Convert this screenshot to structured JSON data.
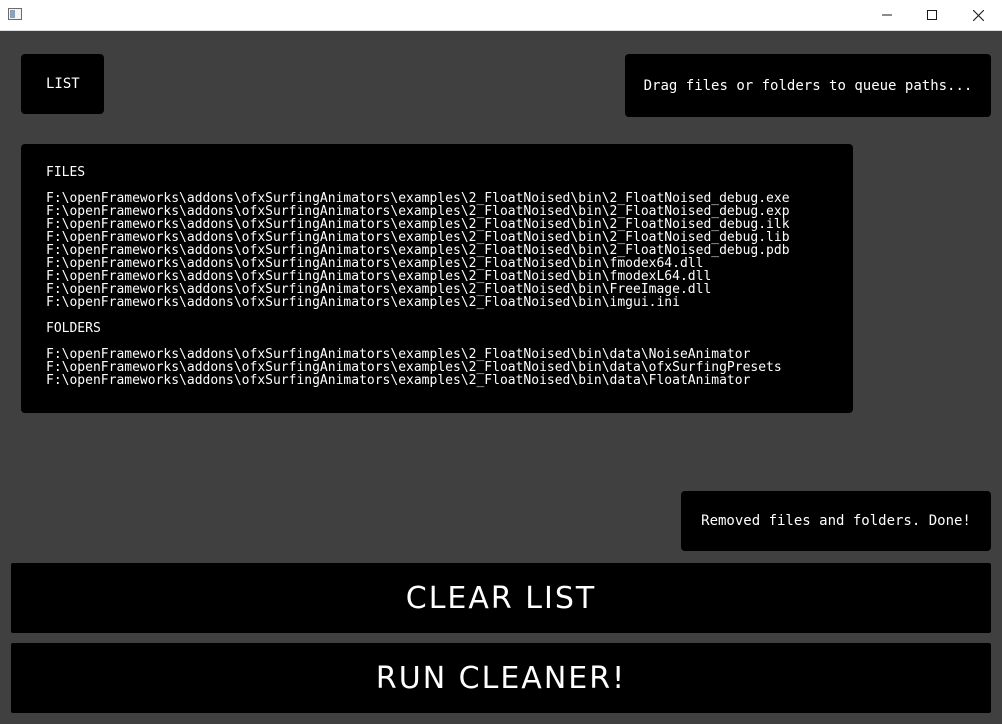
{
  "window": {
    "title": "",
    "controls": {
      "minimize_icon": "minimize-icon",
      "maximize_icon": "maximize-icon",
      "close_icon": "close-icon"
    }
  },
  "list_button": {
    "label": "LIST"
  },
  "drop_zone": {
    "label": "Drag files or folders to queue paths..."
  },
  "queue": {
    "files_heading": "FILES",
    "files": [
      "F:\\openFrameworks\\addons\\ofxSurfingAnimators\\examples\\2_FloatNoised\\bin\\2_FloatNoised_debug.exe",
      "F:\\openFrameworks\\addons\\ofxSurfingAnimators\\examples\\2_FloatNoised\\bin\\2_FloatNoised_debug.exp",
      "F:\\openFrameworks\\addons\\ofxSurfingAnimators\\examples\\2_FloatNoised\\bin\\2_FloatNoised_debug.ilk",
      "F:\\openFrameworks\\addons\\ofxSurfingAnimators\\examples\\2_FloatNoised\\bin\\2_FloatNoised_debug.lib",
      "F:\\openFrameworks\\addons\\ofxSurfingAnimators\\examples\\2_FloatNoised\\bin\\2_FloatNoised_debug.pdb",
      "F:\\openFrameworks\\addons\\ofxSurfingAnimators\\examples\\2_FloatNoised\\bin\\fmodex64.dll",
      "F:\\openFrameworks\\addons\\ofxSurfingAnimators\\examples\\2_FloatNoised\\bin\\fmodexL64.dll",
      "F:\\openFrameworks\\addons\\ofxSurfingAnimators\\examples\\2_FloatNoised\\bin\\FreeImage.dll",
      "F:\\openFrameworks\\addons\\ofxSurfingAnimators\\examples\\2_FloatNoised\\bin\\imgui.ini"
    ],
    "folders_heading": "FOLDERS",
    "folders": [
      "F:\\openFrameworks\\addons\\ofxSurfingAnimators\\examples\\2_FloatNoised\\bin\\data\\NoiseAnimator",
      "F:\\openFrameworks\\addons\\ofxSurfingAnimators\\examples\\2_FloatNoised\\bin\\data\\ofxSurfingPresets",
      "F:\\openFrameworks\\addons\\ofxSurfingAnimators\\examples\\2_FloatNoised\\bin\\data\\FloatAnimator"
    ]
  },
  "status": {
    "message": "Removed files and folders. Done!"
  },
  "actions": {
    "clear_label": "CLEAR LIST",
    "run_label": "RUN CLEANER!"
  },
  "colors": {
    "background": "#404040",
    "panel": "#000000",
    "text": "#ffffff",
    "titlebar": "#ffffff"
  }
}
